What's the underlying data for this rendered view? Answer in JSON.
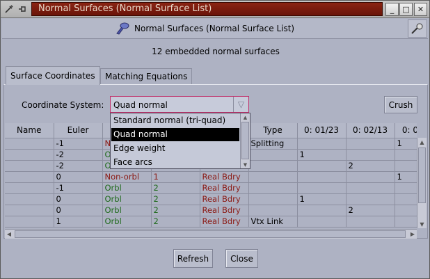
{
  "window": {
    "title": "Normal Surfaces (Normal Surface List)"
  },
  "header": {
    "title": "Normal Surfaces (Normal Surface List)"
  },
  "summary": "12 embedded normal surfaces",
  "tabs": [
    {
      "label": "Surface Coordinates",
      "active": true
    },
    {
      "label": "Matching Equations",
      "active": false
    }
  ],
  "coordinate_system": {
    "label": "Coordinate System:",
    "value": "Quad normal",
    "options": [
      "Standard normal (tri-quad)",
      "Quad normal",
      "Edge weight",
      "Face arcs"
    ],
    "selected_index": 1
  },
  "crush_label": "Crush",
  "table": {
    "columns": [
      "Name",
      "Euler",
      "",
      "",
      "",
      "Type",
      "0: 01/23",
      "0: 02/13",
      "0: 0"
    ],
    "rows": [
      [
        "",
        "-1",
        "No",
        "",
        "",
        "Splitting",
        "",
        "",
        "1"
      ],
      [
        "",
        "-2",
        "O",
        "",
        "",
        "",
        "1",
        "",
        ""
      ],
      [
        "",
        "-2",
        "O",
        "",
        "",
        "",
        "",
        "2",
        ""
      ],
      [
        "",
        "0",
        "Non-orbl",
        "1",
        "Real Bdry",
        "",
        "",
        "",
        "1"
      ],
      [
        "",
        "-1",
        "Orbl",
        "2",
        "Real Bdry",
        "",
        "",
        "",
        ""
      ],
      [
        "",
        "0",
        "Orbl",
        "2",
        "Real Bdry",
        "",
        "1",
        "",
        ""
      ],
      [
        "",
        "0",
        "Orbl",
        "2",
        "Real Bdry",
        "",
        "",
        "2",
        ""
      ],
      [
        "",
        "1",
        "Orbl",
        "2",
        "Real Bdry",
        "Vtx Link",
        "",
        "",
        ""
      ]
    ]
  },
  "buttons": {
    "refresh": "Refresh",
    "close": "Close"
  },
  "colors": {
    "title_bar": "#7a1a0c",
    "non_orientable_text": "#8b1a14",
    "orientable_text": "#1f6a1c",
    "selection": "#000000"
  }
}
